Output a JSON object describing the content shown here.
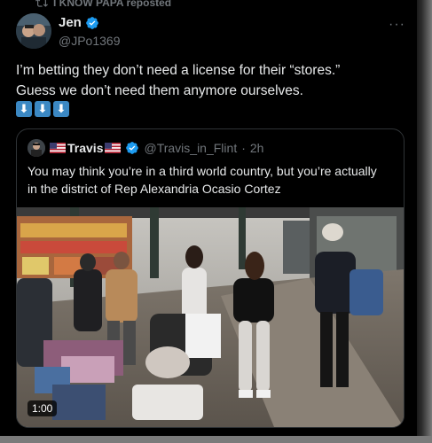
{
  "repost": {
    "label": "I KNOW PAPA reposted",
    "icon": "repost-icon"
  },
  "author": {
    "name": "Jen",
    "handle": "@JPo1369",
    "verified_color": "#1d9bf0"
  },
  "more_label": "···",
  "tweet": {
    "line1": "I’m betting they don’t need a license for their “stores.”",
    "line2": "Guess we don’t need them anymore ourselves.",
    "emoji": [
      "⬇",
      "⬇",
      "⬇"
    ]
  },
  "quote": {
    "name": "Travis",
    "handle": "@Travis_in_Flint",
    "separator": "·",
    "time": "2h",
    "line1": "You may think you’re in a third world country, but you’re actually",
    "line2": "in the district of Rep Alexandria Ocasio Cortez",
    "video_duration": "1:00"
  },
  "colors": {
    "background": "#000000",
    "text": "#e7e9ea",
    "muted": "#71767b",
    "border": "#2f3336",
    "accent": "#1d9bf0"
  }
}
